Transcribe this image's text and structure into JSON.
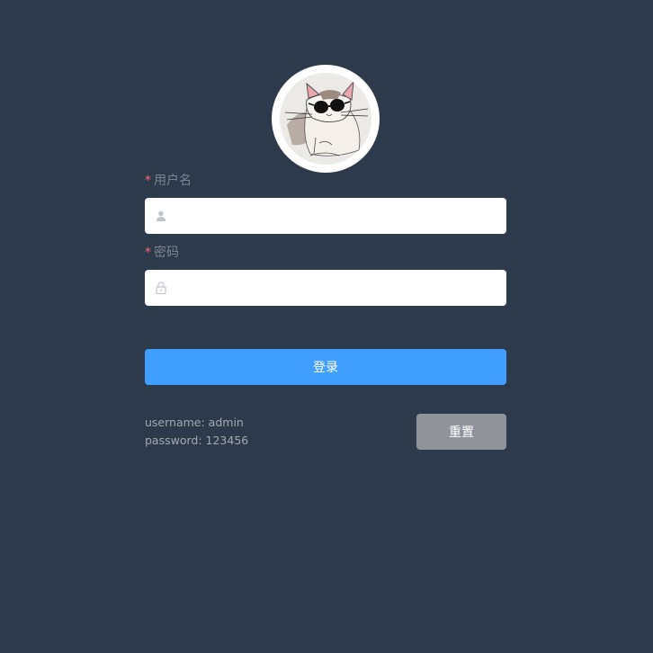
{
  "avatar": {
    "icon": "cat-with-sunglasses-avatar"
  },
  "form": {
    "username": {
      "required_mark": "*",
      "label": "用户名",
      "value": "",
      "placeholder": "",
      "icon": "user-icon"
    },
    "password": {
      "required_mark": "*",
      "label": "密码",
      "value": "",
      "placeholder": "",
      "icon": "lock-icon"
    },
    "login_label": "登录",
    "reset_label": "重置"
  },
  "tips": {
    "username_line": "username: admin",
    "password_line": "password: 123456"
  },
  "colors": {
    "background": "#2d3a4b",
    "primary": "#409eff",
    "reset": "#909399",
    "required": "#f56c6c"
  }
}
